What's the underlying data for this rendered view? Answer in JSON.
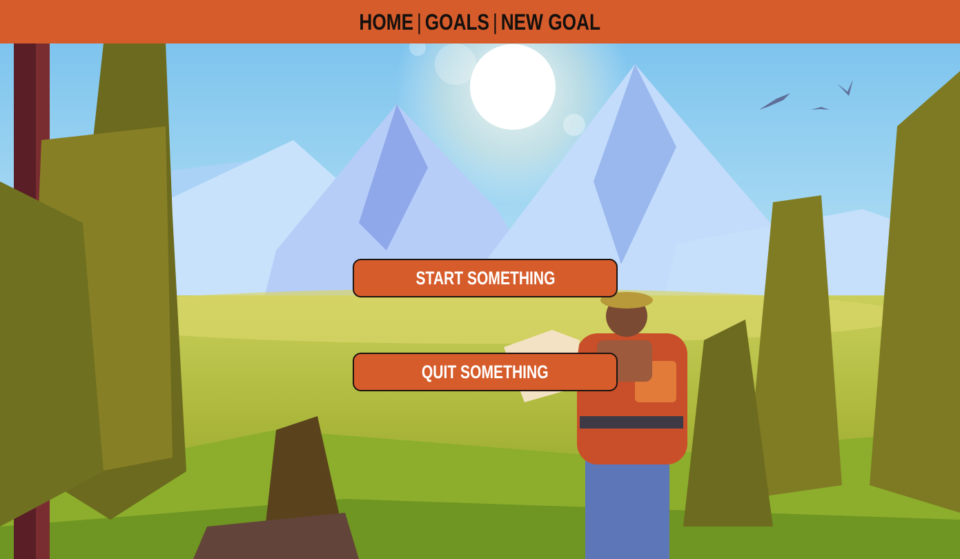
{
  "nav": {
    "items": [
      {
        "label": "Home"
      },
      {
        "label": "Goals"
      },
      {
        "label": "New Goal"
      }
    ],
    "separator": "|"
  },
  "actions": {
    "start_label": "Start Something",
    "quit_label": "Quit Something"
  },
  "colors": {
    "accent": "#d65c2b",
    "nav_text": "#14100e",
    "button_text": "#ffffff"
  },
  "background": {
    "description_icon": "hiker-mountain-landscape-illustration"
  }
}
